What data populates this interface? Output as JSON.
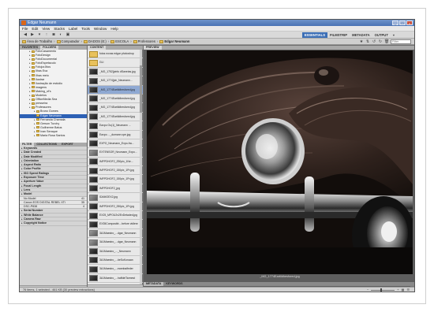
{
  "window": {
    "title": "Edgar Neumann"
  },
  "menu": [
    "File",
    "Edit",
    "View",
    "Stacks",
    "Label",
    "Tools",
    "Window",
    "Help"
  ],
  "workspaces": {
    "items": [
      "ESSENTIALS",
      "FILMSTRIP",
      "METADATA",
      "OUTPUT"
    ],
    "active": "ESSENTIALS",
    "dropdown": "▾"
  },
  "path": {
    "crumbs": [
      "Área de Trabalho",
      "Computador",
      "DADOS (E:)",
      "ESCOLA",
      "Professores",
      "Edgar Neumann"
    ]
  },
  "search": {
    "placeholder": "Filter"
  },
  "left_tabs": [
    "FAVORITES",
    "FOLDERS"
  ],
  "folders": [
    {
      "label": "FotoCasamento",
      "depth": 2
    },
    {
      "label": "FotoDesign",
      "depth": 2
    },
    {
      "label": "FotoDocumental",
      "depth": 2
    },
    {
      "label": "FotoEspetaculo",
      "depth": 2
    },
    {
      "label": "FotojorJitos",
      "depth": 2
    },
    {
      "label": "Ilhas Eva",
      "depth": 2
    },
    {
      "label": "Ilhas meio",
      "depth": 2
    },
    {
      "label": "Ilustrar",
      "depth": 2
    },
    {
      "label": "Ilustração de estúdio",
      "depth": 2
    },
    {
      "label": "imagens",
      "depth": 2
    },
    {
      "label": "Making_of's",
      "depth": 2
    },
    {
      "label": "Modelos",
      "depth": 2
    },
    {
      "label": "OfficeMedia Sea",
      "depth": 2
    },
    {
      "label": "presseira",
      "depth": 2
    },
    {
      "label": "Professores",
      "depth": 2
    },
    {
      "label": "Bruno Gomes",
      "depth": 3
    },
    {
      "label": "Edgar Neumann",
      "depth": 3,
      "selected": true
    },
    {
      "label": "Fernanda Chamala",
      "depth": 3
    },
    {
      "label": "Gerson Turchy",
      "depth": 3
    },
    {
      "label": "Guilherme Batus",
      "depth": 3
    },
    {
      "label": "Ivan Seraque",
      "depth": 3
    },
    {
      "label": "Maria Rosa Santos",
      "depth": 3
    }
  ],
  "filter_tabs": [
    "FILTER",
    "COLLECTIONS",
    "EXPORT"
  ],
  "filters": [
    {
      "label": "Keywords",
      "type": "h"
    },
    {
      "label": "Date Created",
      "type": "h"
    },
    {
      "label": "Date Modified",
      "type": "h"
    },
    {
      "label": "Orientation",
      "type": "h"
    },
    {
      "label": "Aspect Ratio",
      "type": "h"
    },
    {
      "label": "Color Profile",
      "type": "h"
    },
    {
      "label": "ISO Speed Ratings",
      "type": "h"
    },
    {
      "label": "Exposure Time",
      "type": "h"
    },
    {
      "label": "Aperture Value",
      "type": "h"
    },
    {
      "label": "Focal Length",
      "type": "h"
    },
    {
      "label": "Lens",
      "type": "h"
    },
    {
      "label": "Model",
      "type": "h"
    },
    {
      "label": "No Model",
      "type": "sub",
      "count": "41"
    },
    {
      "label": "Canon EOS DIGITAL REBEL XTi",
      "type": "sub",
      "count": "35"
    },
    {
      "label": "DSC-P838",
      "type": "sub",
      "count": "4"
    },
    {
      "label": "Serial Number",
      "type": "h"
    },
    {
      "label": "White Balance",
      "type": "h"
    },
    {
      "label": "Camera Raw",
      "type": "h"
    },
    {
      "label": "Copyright Notice",
      "type": "h"
    }
  ],
  "content_tab": "CONTENT",
  "files": [
    {
      "label": "fotos novas edgar photoshop",
      "kind": "folder"
    },
    {
      "label": "GLI",
      "kind": "folder"
    },
    {
      "label": "_MG_1752[pinfu dSaneias.jpg",
      "kind": "dark"
    },
    {
      "label": "_MG_1774[pin_Neumann...",
      "kind": "dark"
    },
    {
      "label": "_MG_1774Eartildhesfored.jpg",
      "kind": "dark",
      "selected": true
    },
    {
      "label": "_MG_1774Eartildhesfored.jpg",
      "kind": "dark"
    },
    {
      "label": "_MG_1774Eartildhesfored.jpg",
      "kind": "dark"
    },
    {
      "label": "_MG_1774Eartildhesfored.jpg",
      "kind": "dark"
    },
    {
      "label": "Eaxpo Ou(1)_Neumann ...",
      "kind": "dark"
    },
    {
      "label": "Eaxpo ..._dumann cpe.jpg",
      "kind": "dark"
    },
    {
      "label": "EXPO_Neumann_Expo-fra...",
      "kind": "dark"
    },
    {
      "label": "EXTENSOR_Neumann_Expo...",
      "kind": "light"
    },
    {
      "label": "IMFPDHOF2_Z50pix_1Ne...",
      "kind": "dark"
    },
    {
      "label": "IMFPDHOF2_150pix_1Pr.jpg",
      "kind": "dark"
    },
    {
      "label": "IMFPDHOF2_150pix_1Pr.jpg",
      "kind": "dark"
    },
    {
      "label": "IMFPDHOF2_jpg",
      "kind": "dark"
    },
    {
      "label": "IDAMOEX2.jpg",
      "kind": "light"
    },
    {
      "label": "IMFPDHOF2_250pix_1Pr.jpg",
      "kind": "dark"
    },
    {
      "label": "EX25_MPOU2v2ExDetaded.jpg",
      "kind": "dark"
    },
    {
      "label": "EX35Composité....before vidlenr",
      "kind": "dark"
    },
    {
      "label": "3A1Maestro_...dgar_Neumann",
      "kind": "light"
    },
    {
      "label": "3A1Maestro_...dgar_Neumann",
      "kind": "light"
    },
    {
      "label": "3A1Maestro_..._Neumann",
      "kind": "dark"
    },
    {
      "label": "3A1Maestro_...#eSuKonaan",
      "kind": "dark"
    },
    {
      "label": "3A1Maestro_...eannbaifeder",
      "kind": "dark"
    },
    {
      "label": "3A1Maestro_...haffdelTarmest",
      "kind": "dark"
    },
    {
      "label": "3A1Maestro_(4_CabotinaPerch",
      "kind": "dark"
    },
    {
      "label": "3A1Maestro_...tradiaMadarc",
      "kind": "dark"
    },
    {
      "label": "3A1Maestro_...ronfeedlmagr",
      "kind": "dark"
    },
    {
      "label": "3A1Maestro_...radpiao9Pan",
      "kind": "dark"
    }
  ],
  "preview_tab": "PREVIEW",
  "preview_caption": "_MG_1774Eartildhesfored.jpg",
  "meta_tabs": [
    "METADATA",
    "KEYWORDS"
  ],
  "status": {
    "text": "76 items, 1 selected - 461 KB (30 preview extractions)"
  }
}
